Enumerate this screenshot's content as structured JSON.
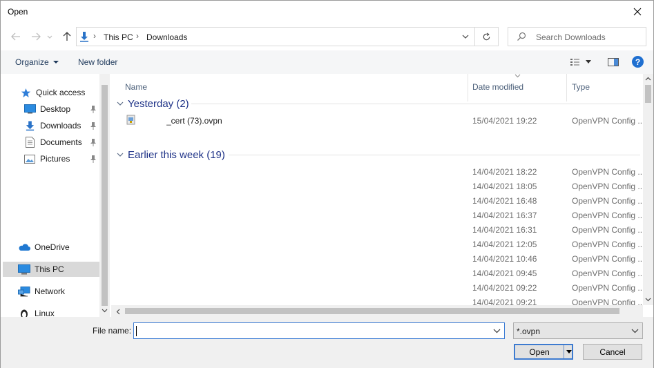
{
  "window": {
    "title": "Open"
  },
  "address": {
    "crumbs": [
      "This PC",
      "Downloads"
    ],
    "search_placeholder": "Search Downloads"
  },
  "toolbar": {
    "organize_label": "Organize",
    "new_folder_label": "New folder",
    "help_label": "?"
  },
  "navpane": {
    "items": [
      {
        "label": "Quick access",
        "icon": "star-icon",
        "pinned": false
      },
      {
        "label": "Desktop",
        "icon": "desktop-icon",
        "pinned": true
      },
      {
        "label": "Downloads",
        "icon": "download-arrow-icon",
        "pinned": true
      },
      {
        "label": "Documents",
        "icon": "document-icon",
        "pinned": true
      },
      {
        "label": "Pictures",
        "icon": "pictures-icon",
        "pinned": true
      },
      {
        "label": "OneDrive",
        "icon": "cloud-icon",
        "pinned": false
      },
      {
        "label": "This PC",
        "icon": "computer-icon",
        "pinned": false,
        "selected": true
      },
      {
        "label": "Network",
        "icon": "network-icon",
        "pinned": false
      },
      {
        "label": "Linux",
        "icon": "penguin-icon",
        "pinned": false
      }
    ]
  },
  "columns": {
    "name": "Name",
    "date": "Date modified",
    "type": "Type"
  },
  "groups": [
    {
      "label": "Yesterday (2)",
      "rows": [
        {
          "name": "_cert (73).ovpn",
          "date": "15/04/2021 19:22",
          "type": "OpenVPN Config ..."
        }
      ]
    },
    {
      "label": "Earlier this week (19)",
      "rows": [
        {
          "name": "",
          "date": "14/04/2021 18:22",
          "type": "OpenVPN Config ..."
        },
        {
          "name": "",
          "date": "14/04/2021 18:05",
          "type": "OpenVPN Config ..."
        },
        {
          "name": "",
          "date": "14/04/2021 16:48",
          "type": "OpenVPN Config ..."
        },
        {
          "name": "",
          "date": "14/04/2021 16:37",
          "type": "OpenVPN Config ..."
        },
        {
          "name": "",
          "date": "14/04/2021 16:31",
          "type": "OpenVPN Config ..."
        },
        {
          "name": "",
          "date": "14/04/2021 12:05",
          "type": "OpenVPN Config ..."
        },
        {
          "name": "",
          "date": "14/04/2021 10:46",
          "type": "OpenVPN Config ..."
        },
        {
          "name": "",
          "date": "14/04/2021 09:45",
          "type": "OpenVPN Config ..."
        },
        {
          "name": "",
          "date": "14/04/2021 09:22",
          "type": "OpenVPN Config ..."
        },
        {
          "name": "",
          "date": "14/04/2021 09:21",
          "type": "OpenVPN Config ..."
        }
      ]
    }
  ],
  "bottom": {
    "file_name_label": "File name:",
    "file_name_value": "",
    "filter_value": "*.ovpn",
    "open_label": "Open",
    "cancel_label": "Cancel"
  },
  "colors": {
    "accent": "#1f6fd0",
    "group_text": "#1e3287",
    "selection": "#d9d9d9"
  }
}
